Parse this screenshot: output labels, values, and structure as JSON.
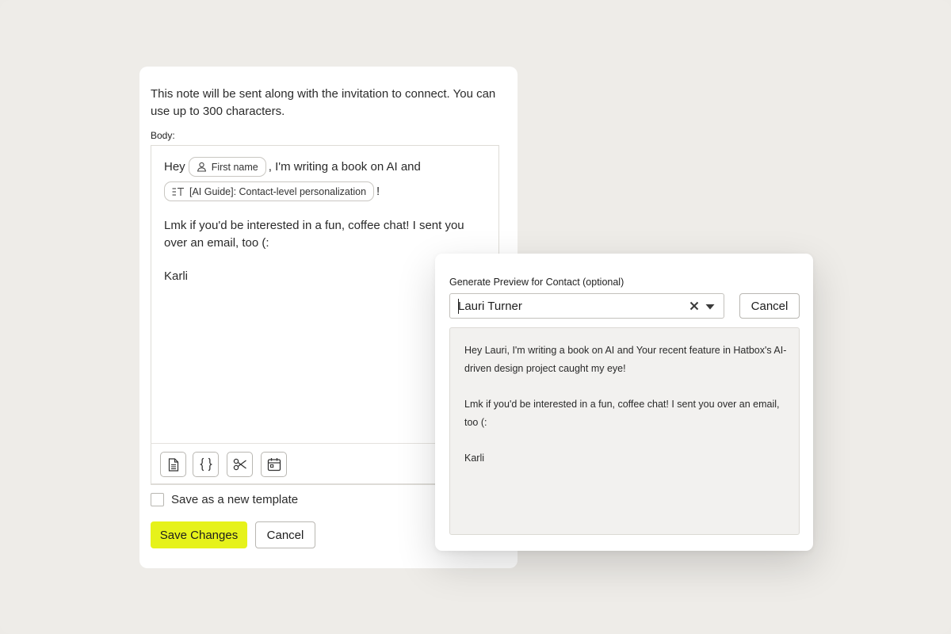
{
  "editor": {
    "intro": "This note will be sent along with the invitation to connect. You can use up to 300 characters.",
    "body_label": "Body:",
    "body": {
      "greeting": "Hey",
      "first_name_chip": "First name",
      "after_chip": ", I'm writing a book on AI and",
      "ai_chip": "[AI Guide]: Contact-level personalization",
      "after_ai_chip": "!",
      "paragraph": "Lmk if you'd be interested in a fun, coffee chat! I sent you over an email, too (:",
      "signature": "Karli"
    },
    "toolbar": {
      "icons": [
        "document-icon",
        "braces-icon",
        "scissors-icon",
        "calendar-icon"
      ]
    },
    "save_template_label": "Save as a new template",
    "save_label": "Save Changes",
    "cancel_label": "Cancel"
  },
  "preview": {
    "label": "Generate Preview for Contact (optional)",
    "contact_value": "Lauri Turner",
    "cancel_label": "Cancel",
    "message": {
      "line1": "Hey Lauri, I'm writing a book on AI and Your recent feature in Hatbox's AI-driven design project caught my eye!",
      "line2": "Lmk if you'd be interested in a fun, coffee chat! I sent you over an email, too (:",
      "signature": "Karli"
    }
  },
  "colors": {
    "background": "#edebe7",
    "accent": "#e6f21a",
    "preview_bg": "#f2f1ef"
  }
}
